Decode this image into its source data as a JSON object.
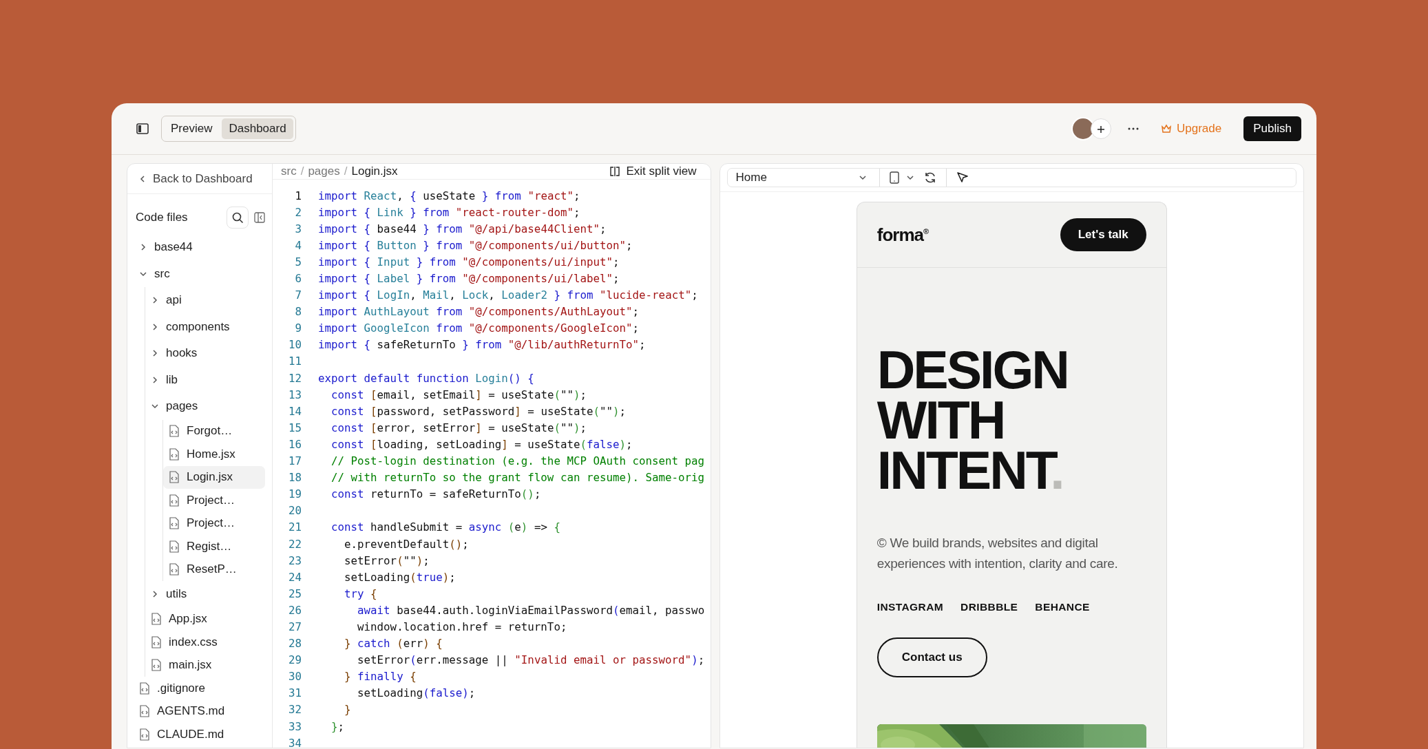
{
  "topbar": {
    "modes": [
      {
        "label": "Preview",
        "selected": false
      },
      {
        "label": "Dashboard",
        "selected": true
      }
    ],
    "upgrade": "Upgrade",
    "publish": "Publish"
  },
  "sidebar": {
    "back": "Back to Dashboard",
    "title": "Code files",
    "tree": [
      {
        "label": "base44",
        "kind": "folder",
        "expanded": false
      },
      {
        "label": "src",
        "kind": "folder",
        "expanded": true,
        "children": [
          {
            "label": "api",
            "kind": "folder",
            "expanded": false
          },
          {
            "label": "components",
            "kind": "folder",
            "expanded": false
          },
          {
            "label": "hooks",
            "kind": "folder",
            "expanded": false
          },
          {
            "label": "lib",
            "kind": "folder",
            "expanded": false
          },
          {
            "label": "pages",
            "kind": "folder",
            "expanded": true,
            "children": [
              {
                "label": "Forgot…",
                "kind": "file",
                "selected": false
              },
              {
                "label": "Home.jsx",
                "kind": "file",
                "selected": false
              },
              {
                "label": "Login.jsx",
                "kind": "file",
                "selected": true
              },
              {
                "label": "Project…",
                "kind": "file",
                "selected": false
              },
              {
                "label": "Project…",
                "kind": "file",
                "selected": false
              },
              {
                "label": "Regist…",
                "kind": "file",
                "selected": false
              },
              {
                "label": "ResetP…",
                "kind": "file",
                "selected": false
              }
            ]
          },
          {
            "label": "utils",
            "kind": "folder",
            "expanded": false
          },
          {
            "label": "App.jsx",
            "kind": "file",
            "selected": false
          },
          {
            "label": "index.css",
            "kind": "file",
            "selected": false
          },
          {
            "label": "main.jsx",
            "kind": "file",
            "selected": false
          }
        ]
      },
      {
        "label": ".gitignore",
        "kind": "file",
        "selected": false
      },
      {
        "label": "AGENTS.md",
        "kind": "file",
        "selected": false
      },
      {
        "label": "CLAUDE.md",
        "kind": "file",
        "selected": false
      }
    ]
  },
  "editor": {
    "breadcrumb": [
      {
        "kind": "folder",
        "text": "src"
      },
      {
        "kind": "separator",
        "text": "/"
      },
      {
        "kind": "folder",
        "text": "pages"
      },
      {
        "kind": "separator",
        "text": "/"
      },
      {
        "kind": "file",
        "text": "Login.jsx"
      }
    ],
    "exit": "Exit split view",
    "lines": [
      {
        "n": "1",
        "t": [
          {
            "kind": "keyword",
            "text": "import"
          },
          {
            "kind": "type",
            "text": " React"
          },
          {
            "kind": "plain",
            "text": ", "
          },
          {
            "kind": "keyword",
            "text": "{"
          },
          {
            "kind": "plain",
            "text": " useState "
          },
          {
            "kind": "keyword",
            "text": "}"
          },
          {
            "kind": "keyword",
            "text": " from"
          },
          {
            "kind": "string",
            "text": " \"react\""
          },
          {
            "kind": "plain",
            "text": ";"
          }
        ]
      },
      {
        "n": "2",
        "t": [
          {
            "kind": "keyword",
            "text": "import {"
          },
          {
            "kind": "type",
            "text": " Link"
          },
          {
            "kind": "keyword",
            "text": " } from"
          },
          {
            "kind": "string",
            "text": " \"react-router-dom\""
          },
          {
            "kind": "plain",
            "text": ";"
          }
        ]
      },
      {
        "n": "3",
        "t": [
          {
            "kind": "keyword",
            "text": "import {"
          },
          {
            "kind": "plain",
            "text": " base44"
          },
          {
            "kind": "keyword",
            "text": " } from"
          },
          {
            "kind": "string",
            "text": " \"@/api/base44Client\""
          },
          {
            "kind": "plain",
            "text": ";"
          }
        ]
      },
      {
        "n": "4",
        "t": [
          {
            "kind": "keyword",
            "text": "import {"
          },
          {
            "kind": "type",
            "text": " Button"
          },
          {
            "kind": "keyword",
            "text": " } from"
          },
          {
            "kind": "string",
            "text": " \"@/components/ui/button\""
          },
          {
            "kind": "plain",
            "text": ";"
          }
        ]
      },
      {
        "n": "5",
        "t": [
          {
            "kind": "keyword",
            "text": "import {"
          },
          {
            "kind": "type",
            "text": " Input"
          },
          {
            "kind": "keyword",
            "text": " } from"
          },
          {
            "kind": "string",
            "text": " \"@/components/ui/input\""
          },
          {
            "kind": "plain",
            "text": ";"
          }
        ]
      },
      {
        "n": "6",
        "t": [
          {
            "kind": "keyword",
            "text": "import {"
          },
          {
            "kind": "type",
            "text": " Label"
          },
          {
            "kind": "keyword",
            "text": " } from"
          },
          {
            "kind": "string",
            "text": " \"@/components/ui/label\""
          },
          {
            "kind": "plain",
            "text": ";"
          }
        ]
      },
      {
        "n": "7",
        "t": [
          {
            "kind": "keyword",
            "text": "import {"
          },
          {
            "kind": "type",
            "text": " LogIn"
          },
          {
            "kind": "plain",
            "text": ", "
          },
          {
            "kind": "type",
            "text": "Mail"
          },
          {
            "kind": "plain",
            "text": ", "
          },
          {
            "kind": "type",
            "text": "Lock"
          },
          {
            "kind": "plain",
            "text": ", "
          },
          {
            "kind": "type",
            "text": "Loader2"
          },
          {
            "kind": "keyword",
            "text": " } from"
          },
          {
            "kind": "string",
            "text": " \"lucide-react\""
          },
          {
            "kind": "plain",
            "text": ";"
          }
        ]
      },
      {
        "n": "8",
        "t": [
          {
            "kind": "keyword",
            "text": "import"
          },
          {
            "kind": "type",
            "text": " AuthLayout"
          },
          {
            "kind": "keyword",
            "text": " from"
          },
          {
            "kind": "string",
            "text": " \"@/components/AuthLayout\""
          },
          {
            "kind": "plain",
            "text": ";"
          }
        ]
      },
      {
        "n": "9",
        "t": [
          {
            "kind": "keyword",
            "text": "import"
          },
          {
            "kind": "type",
            "text": " GoogleIcon"
          },
          {
            "kind": "keyword",
            "text": " from"
          },
          {
            "kind": "string",
            "text": " \"@/components/GoogleIcon\""
          },
          {
            "kind": "plain",
            "text": ";"
          }
        ]
      },
      {
        "n": "10",
        "t": [
          {
            "kind": "keyword",
            "text": "import {"
          },
          {
            "kind": "plain",
            "text": " safeReturnTo"
          },
          {
            "kind": "keyword",
            "text": " } from"
          },
          {
            "kind": "string",
            "text": " \"@/lib/authReturnTo\""
          },
          {
            "kind": "plain",
            "text": ";"
          }
        ]
      },
      {
        "n": "11"
      },
      {
        "n": "12",
        "t": [
          {
            "kind": "keyword",
            "text": "export default function"
          },
          {
            "kind": "type",
            "text": " Login"
          },
          {
            "kind": "keyword",
            "text": "() {"
          }
        ]
      },
      {
        "n": "13",
        "t": [
          {
            "kind": "keyword",
            "text": "  const"
          },
          {
            "kind": "bracket",
            "text": " ["
          },
          {
            "kind": "plain",
            "text": "email, setEmail"
          },
          {
            "kind": "bracket",
            "text": "]"
          },
          {
            "kind": "plain",
            "text": " = useState"
          },
          {
            "kind": "paren",
            "text": "("
          },
          {
            "kind": "plain",
            "text": "\"\""
          },
          {
            "kind": "paren",
            "text": ")"
          },
          {
            "kind": "plain",
            "text": ";"
          }
        ]
      },
      {
        "n": "14",
        "t": [
          {
            "kind": "keyword",
            "text": "  const"
          },
          {
            "kind": "bracket",
            "text": " ["
          },
          {
            "kind": "plain",
            "text": "password, setPassword"
          },
          {
            "kind": "bracket",
            "text": "]"
          },
          {
            "kind": "plain",
            "text": " = useState"
          },
          {
            "kind": "paren",
            "text": "("
          },
          {
            "kind": "plain",
            "text": "\"\""
          },
          {
            "kind": "paren",
            "text": ")"
          },
          {
            "kind": "plain",
            "text": ";"
          }
        ]
      },
      {
        "n": "15",
        "t": [
          {
            "kind": "keyword",
            "text": "  const"
          },
          {
            "kind": "bracket",
            "text": " ["
          },
          {
            "kind": "plain",
            "text": "error, setError"
          },
          {
            "kind": "bracket",
            "text": "]"
          },
          {
            "kind": "plain",
            "text": " = useState"
          },
          {
            "kind": "paren",
            "text": "("
          },
          {
            "kind": "plain",
            "text": "\"\""
          },
          {
            "kind": "paren",
            "text": ")"
          },
          {
            "kind": "plain",
            "text": ";"
          }
        ]
      },
      {
        "n": "16",
        "t": [
          {
            "kind": "keyword",
            "text": "  const"
          },
          {
            "kind": "bracket",
            "text": " ["
          },
          {
            "kind": "plain",
            "text": "loading, setLoading"
          },
          {
            "kind": "bracket",
            "text": "]"
          },
          {
            "kind": "plain",
            "text": " = useState"
          },
          {
            "kind": "paren",
            "text": "("
          },
          {
            "kind": "keyword",
            "text": "false"
          },
          {
            "kind": "paren",
            "text": ")"
          },
          {
            "kind": "plain",
            "text": ";"
          }
        ]
      },
      {
        "n": "17",
        "t": [
          {
            "kind": "comment",
            "text": "  // Post-login destination (e.g. the MCP OAuth consent pag"
          }
        ]
      },
      {
        "n": "18",
        "t": [
          {
            "kind": "comment",
            "text": "  // with returnTo so the grant flow can resume). Same-orig"
          }
        ]
      },
      {
        "n": "19",
        "t": [
          {
            "kind": "keyword",
            "text": "  const"
          },
          {
            "kind": "plain",
            "text": " returnTo = safeReturnTo"
          },
          {
            "kind": "paren",
            "text": "()"
          },
          {
            "kind": "plain",
            "text": ";"
          }
        ]
      },
      {
        "n": "20"
      },
      {
        "n": "21",
        "t": [
          {
            "kind": "keyword",
            "text": "  const"
          },
          {
            "kind": "plain",
            "text": " handleSubmit = "
          },
          {
            "kind": "keyword",
            "text": "async"
          },
          {
            "kind": "paren",
            "text": " ("
          },
          {
            "kind": "plain",
            "text": "e"
          },
          {
            "kind": "paren",
            "text": ")"
          },
          {
            "kind": "plain",
            "text": " => "
          },
          {
            "kind": "paren",
            "text": "{"
          }
        ]
      },
      {
        "n": "22",
        "t": [
          {
            "kind": "plain",
            "text": "    e.preventDefault"
          },
          {
            "kind": "bracket",
            "text": "()"
          },
          {
            "kind": "plain",
            "text": ";"
          }
        ]
      },
      {
        "n": "23",
        "t": [
          {
            "kind": "plain",
            "text": "    setError"
          },
          {
            "kind": "bracket",
            "text": "("
          },
          {
            "kind": "plain",
            "text": "\"\""
          },
          {
            "kind": "bracket",
            "text": ")"
          },
          {
            "kind": "plain",
            "text": ";"
          }
        ]
      },
      {
        "n": "24",
        "t": [
          {
            "kind": "plain",
            "text": "    setLoading"
          },
          {
            "kind": "bracket",
            "text": "("
          },
          {
            "kind": "keyword",
            "text": "true"
          },
          {
            "kind": "bracket",
            "text": ")"
          },
          {
            "kind": "plain",
            "text": ";"
          }
        ]
      },
      {
        "n": "25",
        "t": [
          {
            "kind": "keyword",
            "text": "    try"
          },
          {
            "kind": "bracket",
            "text": " {"
          }
        ]
      },
      {
        "n": "26",
        "t": [
          {
            "kind": "keyword",
            "text": "      await"
          },
          {
            "kind": "plain",
            "text": " base44.auth.loginViaEmailPassword"
          },
          {
            "kind": "keyword",
            "text": "("
          },
          {
            "kind": "plain",
            "text": "email, passwo"
          }
        ]
      },
      {
        "n": "27",
        "t": [
          {
            "kind": "plain",
            "text": "      window.location.href = returnTo;"
          }
        ]
      },
      {
        "n": "28",
        "t": [
          {
            "kind": "bracket",
            "text": "    }"
          },
          {
            "kind": "keyword",
            "text": " catch"
          },
          {
            "kind": "bracket",
            "text": " ("
          },
          {
            "kind": "plain",
            "text": "err"
          },
          {
            "kind": "bracket",
            "text": ") {"
          }
        ]
      },
      {
        "n": "29",
        "t": [
          {
            "kind": "plain",
            "text": "      setError"
          },
          {
            "kind": "keyword",
            "text": "("
          },
          {
            "kind": "plain",
            "text": "err.message || "
          },
          {
            "kind": "string",
            "text": "\"Invalid email or password\""
          },
          {
            "kind": "keyword",
            "text": ")"
          },
          {
            "kind": "plain",
            "text": ";"
          }
        ]
      },
      {
        "n": "30",
        "t": [
          {
            "kind": "bracket",
            "text": "    }"
          },
          {
            "kind": "keyword",
            "text": " finally"
          },
          {
            "kind": "bracket",
            "text": " {"
          }
        ]
      },
      {
        "n": "31",
        "t": [
          {
            "kind": "plain",
            "text": "      setLoading"
          },
          {
            "kind": "keyword",
            "text": "(false)"
          },
          {
            "kind": "plain",
            "text": ";"
          }
        ]
      },
      {
        "n": "32",
        "t": [
          {
            "kind": "bracket",
            "text": "    }"
          }
        ]
      },
      {
        "n": "33",
        "t": [
          {
            "kind": "paren",
            "text": "  }"
          },
          {
            "kind": "plain",
            "text": ";"
          }
        ]
      },
      {
        "n": "34"
      }
    ]
  },
  "preview": {
    "page": "Home",
    "site": {
      "logo": "forma",
      "logo_mark": "®",
      "cta": "Let's talk",
      "headline": [
        "DESIGN",
        "WITH",
        "INTENT"
      ],
      "headline_dot": ".",
      "intro": "© We build brands, websites and digital experiences with intention, clarity and care.",
      "links": [
        "INSTAGRAM",
        "DRIBBBLE",
        "BEHANCE"
      ],
      "contact": "Contact us",
      "hero": {
        "kind": "picture"
      }
    }
  }
}
